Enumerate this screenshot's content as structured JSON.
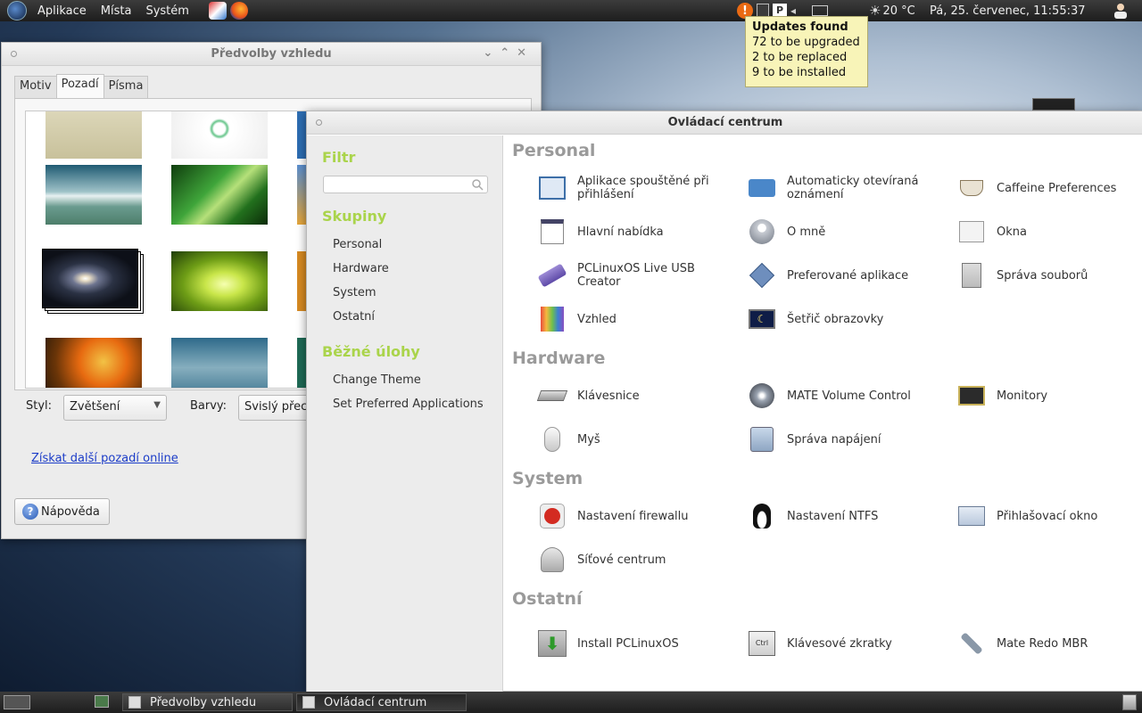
{
  "top_panel": {
    "menus": [
      "Aplikace",
      "Místa",
      "Systém"
    ],
    "weather": "20 °C",
    "datetime": "Pá, 25. červenec, 11:55:37"
  },
  "tooltip": {
    "title": "Updates found",
    "lines": [
      "72 to be upgraded",
      "2 to be replaced",
      "9 to be installed"
    ]
  },
  "appearance": {
    "title": "Předvolby vzhledu",
    "tabs": [
      "Motiv",
      "Pozadí",
      "Písma"
    ],
    "active_tab": "Pozadí",
    "style_label": "Styl:",
    "style_value": "Zvětšení",
    "colors_label": "Barvy:",
    "colors_value": "Svislý přec",
    "more_link": "Získat další pozadí online",
    "help_button": "Nápověda"
  },
  "control_center": {
    "title": "Ovládací centrum",
    "filter_heading": "Filtr",
    "groups_heading": "Skupiny",
    "groups": [
      "Personal",
      "Hardware",
      "System",
      "Ostatní"
    ],
    "tasks_heading": "Běžné úlohy",
    "tasks": [
      "Change Theme",
      "Set Preferred Applications"
    ],
    "categories": [
      {
        "name": "Personal",
        "items": [
          "Aplikace spouštěné při přihlášení",
          "Automaticky otevíraná oznámení",
          "Caffeine Preferences",
          "Hlavní nabídka",
          "O mně",
          "Okna",
          "PCLinuxOS Live USB Creator",
          "Preferované aplikace",
          "Správa souborů",
          "Vzhled",
          "Šetřič obrazovky"
        ]
      },
      {
        "name": "Hardware",
        "items": [
          "Klávesnice",
          "MATE Volume Control",
          "Monitory",
          "Myš",
          "Správa napájení"
        ]
      },
      {
        "name": "System",
        "items": [
          "Nastavení firewallu",
          "Nastavení NTFS",
          "Přihlašovací okno",
          "Síťové centrum"
        ]
      },
      {
        "name": "Ostatní",
        "items": [
          "Install PCLinuxOS",
          "Klávesové zkratky",
          "Mate Redo MBR"
        ]
      }
    ]
  },
  "taskbar": {
    "windows": [
      "Předvolby vzhledu",
      "Ovládací centrum"
    ]
  },
  "colors": {
    "accent_green": "#aad44b",
    "category_gray": "#9a9a9a",
    "link_blue": "#1b3cc8",
    "tooltip_bg": "#f8f4b8"
  }
}
